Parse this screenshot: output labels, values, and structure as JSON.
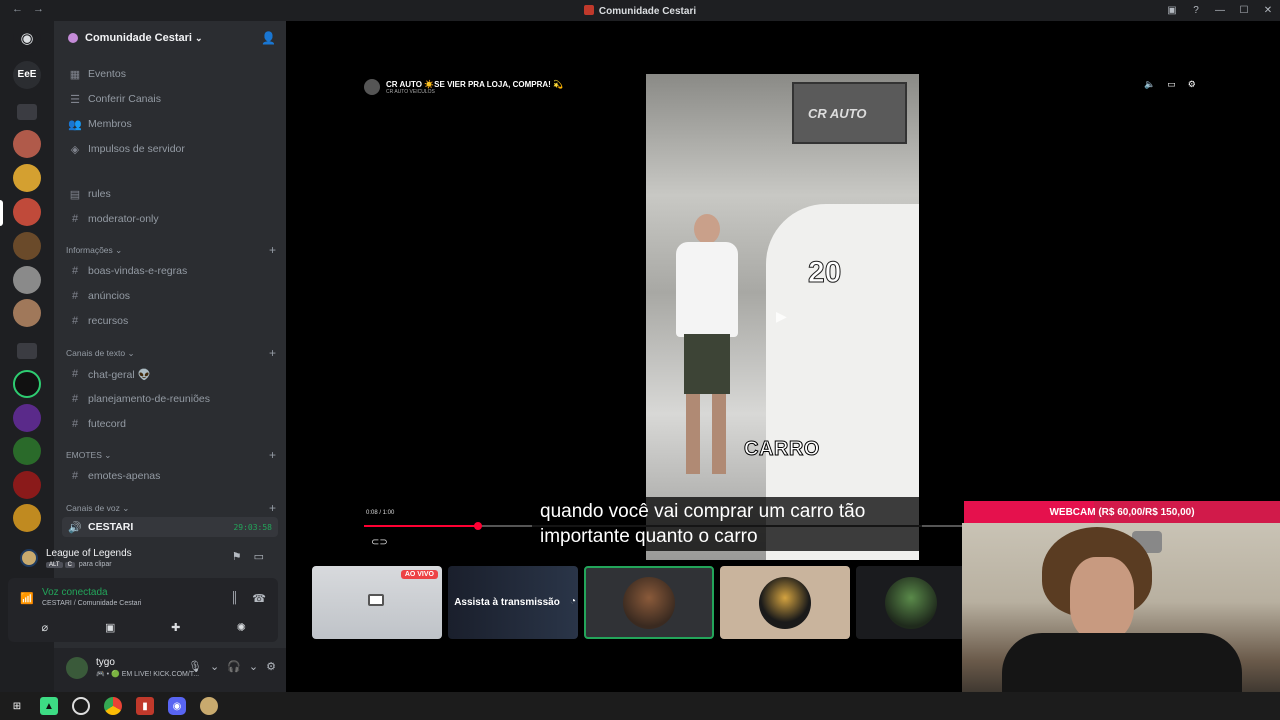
{
  "window": {
    "title": "Comunidade Cestari"
  },
  "server": {
    "name": "Comunidade Cestari"
  },
  "guilds": [
    {
      "label": "EeE"
    }
  ],
  "nav": [
    {
      "label": "Eventos",
      "icon": "calendar-icon"
    },
    {
      "label": "Conferir Canais",
      "icon": "list-icon"
    },
    {
      "label": "Membros",
      "icon": "members-icon"
    },
    {
      "label": "Impulsos de servidor",
      "icon": "boost-icon"
    }
  ],
  "top_channels": [
    {
      "label": "rules",
      "icon": "rules-icon"
    },
    {
      "label": "moderator-only",
      "icon": "hash-icon"
    }
  ],
  "categories": {
    "info": "Informações",
    "text": "Canais de texto",
    "emotes": "EMOTES",
    "voice": "Canais de voz"
  },
  "info_channels": [
    "boas-vindas-e-regras",
    "anúncios",
    "recursos"
  ],
  "text_channels": [
    "chat-geral 👽",
    "planejamento-de-reuniões",
    "futecord"
  ],
  "emote_channels": [
    "emotes-apenas"
  ],
  "voice_channel": {
    "label": "CESTARI",
    "timer": "29:03:58"
  },
  "activity": {
    "game": "League of Legends",
    "hint_key1": "ALT",
    "hint_key2": "C",
    "hint_text": "para clipar"
  },
  "voice": {
    "status": "Voz conectada",
    "location": "CESTARI / Comunidade Cestari"
  },
  "user": {
    "name": "tygo",
    "status": "🎮 • 🟢 EM LIVE! KICK.COM/T..."
  },
  "video": {
    "channel_title": "CR AUTO ☀️SE VIER PRA LOJA, COMPRA! 💫",
    "channel_sub": "CR AUTO VEICULOS",
    "sign_text": "CR AUTO",
    "plate_text": "20",
    "caption": "CARRO",
    "subtitle": "quando você vai comprar um carro tão importante quanto o carro",
    "time": "0:08 / 1:00",
    "progress": 0.19
  },
  "tiles": {
    "live_badge": "AO VIVO",
    "watch_label": "Assista à transmissão"
  },
  "webcam": {
    "label": "WEBCAM (R$ 60,00/R$ 150,00)"
  },
  "colors": {
    "accent_green": "#23a55a",
    "live_red": "#ed4245",
    "webcam_pink": "#e5114d"
  }
}
